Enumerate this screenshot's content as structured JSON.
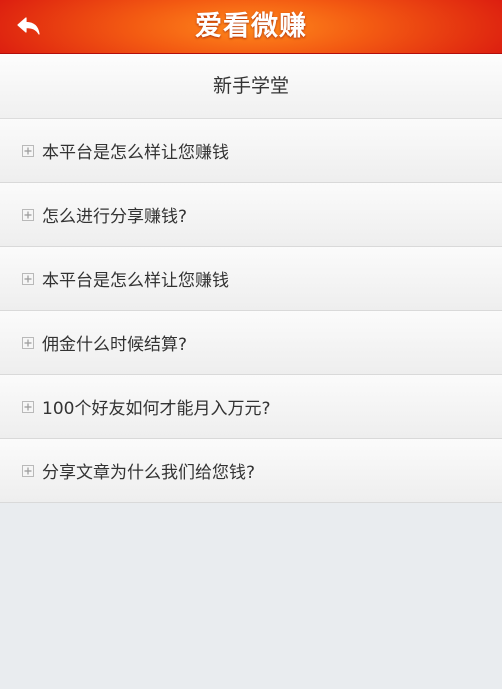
{
  "header": {
    "title": "爱看微赚",
    "back_icon": "back-arrow-icon"
  },
  "section": {
    "title": "新手学堂"
  },
  "faq": [
    {
      "label": "本平台是怎么样让您赚钱"
    },
    {
      "label": "怎么进行分享赚钱?"
    },
    {
      "label": "本平台是怎么样让您赚钱"
    },
    {
      "label": "佣金什么时候结算?"
    },
    {
      "label": "100个好友如何才能月入万元?"
    },
    {
      "label": "分享文章为什么我们给您钱?"
    }
  ],
  "colors": {
    "header_red": "#d8130f",
    "header_orange": "#ff8a1c",
    "background": "#e9ecef"
  }
}
